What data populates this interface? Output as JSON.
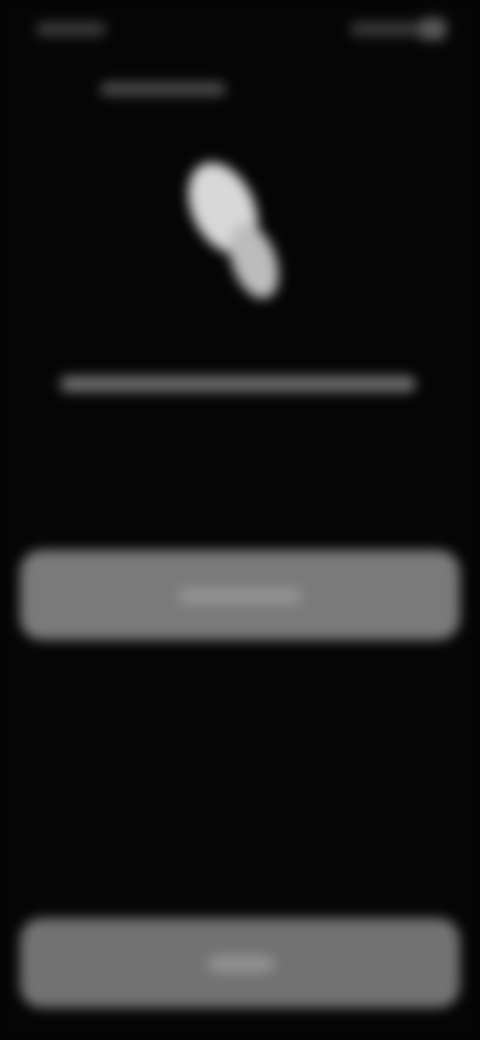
{
  "status_bar": {
    "time": "",
    "icons": [
      "signal-icon",
      "wifi-icon",
      "battery-icon"
    ]
  },
  "header": {
    "title": ""
  },
  "fingerprint": {
    "icon": "fingerprint-icon"
  },
  "instruction": {
    "text": ""
  },
  "buttons": {
    "primary_label": "",
    "secondary_label": ""
  },
  "colors": {
    "background": "#050505",
    "button": "#7a7a7a",
    "icon": "#d8d8d8"
  }
}
